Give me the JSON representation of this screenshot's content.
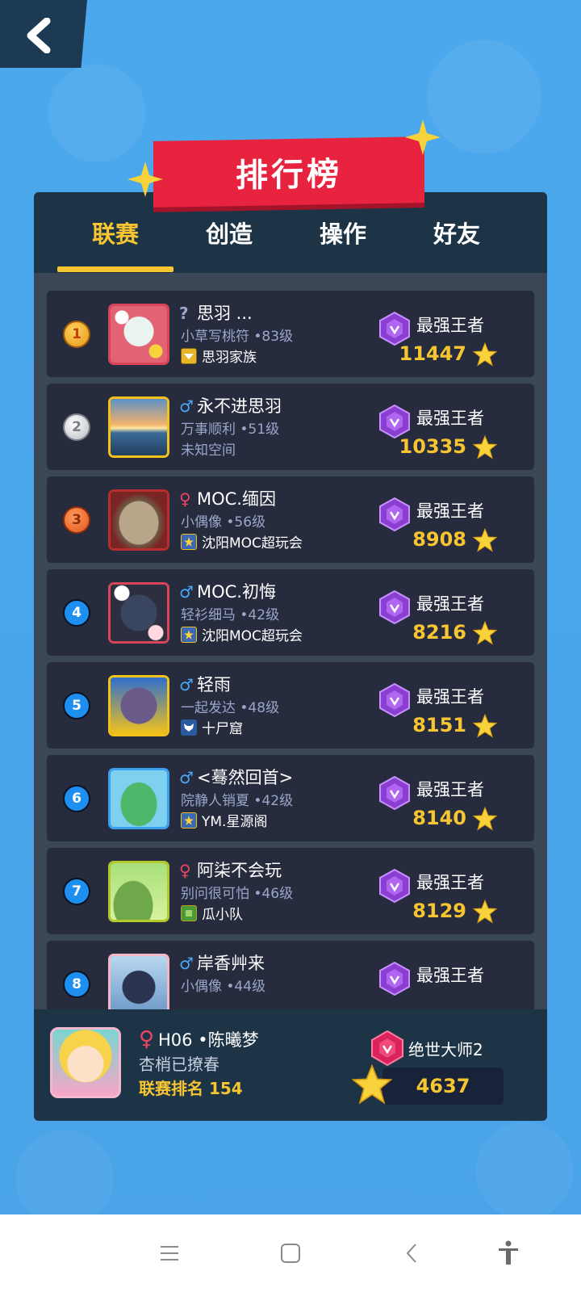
{
  "header": {
    "title": "排行榜",
    "back_icon": "chevron-left-icon"
  },
  "tabs": [
    {
      "label": "联赛",
      "active": true
    },
    {
      "label": "创造",
      "active": false
    },
    {
      "label": "操作",
      "active": false
    },
    {
      "label": "好友",
      "active": false
    }
  ],
  "colors": {
    "accent": "#f7c531",
    "banner": "#e8233f",
    "panel_dark": "#1d3447",
    "row_bg": "#262b3e"
  },
  "rankings": [
    {
      "rank": "1",
      "gender": "?",
      "name": "思羽 ...",
      "title": "小草写桃符 •83级",
      "clan": "思羽家族",
      "tier": "最强王者",
      "score": "11447"
    },
    {
      "rank": "2",
      "gender": "♂",
      "name": "永不进思羽",
      "title": "万事顺利 •51级",
      "clan": "未知空间",
      "tier": "最强王者",
      "score": "10335"
    },
    {
      "rank": "3",
      "gender": "♀",
      "name": "MOC.缅因",
      "title": "小偶像 •56级",
      "clan": "沈阳MOC超玩会",
      "tier": "最强王者",
      "score": "8908"
    },
    {
      "rank": "4",
      "gender": "♂",
      "name": "MOC.初悔",
      "title": "轻衫细马 •42级",
      "clan": "沈阳MOC超玩会",
      "tier": "最强王者",
      "score": "8216"
    },
    {
      "rank": "5",
      "gender": "♂",
      "name": "轻雨",
      "title": "一起发达 •48级",
      "clan": "十尸窟",
      "tier": "最强王者",
      "score": "8151"
    },
    {
      "rank": "6",
      "gender": "♂",
      "name": "<蓦然回首>",
      "title": "院静人销夏 •42级",
      "clan": "YM.星源阁",
      "tier": "最强王者",
      "score": "8140"
    },
    {
      "rank": "7",
      "gender": "♀",
      "name": "阿柒不会玩",
      "title": "别问很可怕 •46级",
      "clan": "瓜小队",
      "tier": "最强王者",
      "score": "8129"
    },
    {
      "rank": "8",
      "gender": "♂",
      "name": "岸香艸来",
      "title": "小偶像 •44级",
      "clan": "",
      "tier": "最强王者",
      "score": ""
    }
  ],
  "me": {
    "gender": "♀",
    "name": "H06 •陈曦梦",
    "title": "杏梢已撩春",
    "rank_label": "联赛排名 154",
    "tier": "绝世大师2",
    "score": "4637"
  },
  "navbar": {
    "menu_icon": "menu-icon",
    "home_icon": "home-square-icon",
    "back_icon": "back-arrow-icon",
    "accessibility_icon": "accessibility-icon"
  }
}
